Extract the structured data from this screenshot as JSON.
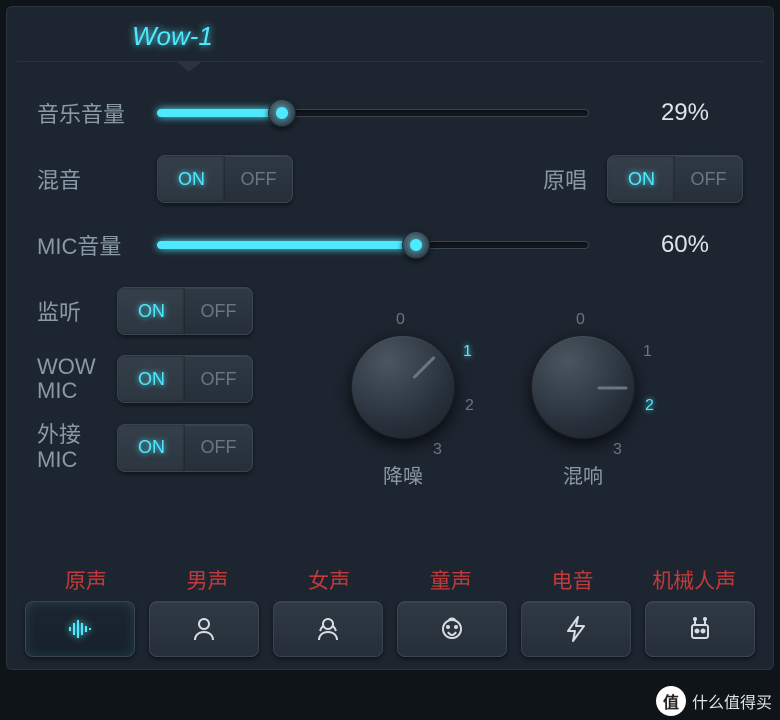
{
  "tab": {
    "title": "Wow-1"
  },
  "sliders": {
    "music": {
      "label": "音乐音量",
      "value": 29,
      "display": "29%"
    },
    "mic": {
      "label": "MIC音量",
      "value": 60,
      "display": "60%"
    }
  },
  "toggles": {
    "mix": {
      "label": "混音",
      "on": "ON",
      "off": "OFF",
      "state": "on"
    },
    "original": {
      "label": "原唱",
      "on": "ON",
      "off": "OFF",
      "state": "on"
    },
    "monitor": {
      "label": "监听",
      "on": "ON",
      "off": "OFF",
      "state": "on"
    },
    "wowmic": {
      "label": "WOW MIC",
      "on": "ON",
      "off": "OFF",
      "state": "on"
    },
    "extmic": {
      "label": "外接 MIC",
      "on": "ON",
      "off": "OFF",
      "state": "on"
    }
  },
  "knobs": {
    "denoise": {
      "label": "降噪",
      "value": 1,
      "ticks": [
        "0",
        "1",
        "2",
        "3"
      ]
    },
    "reverb": {
      "label": "混响",
      "value": 2,
      "ticks": [
        "0",
        "1",
        "2",
        "3"
      ]
    }
  },
  "voices": {
    "labels": [
      "原声",
      "男声",
      "女声",
      "童声",
      "电音",
      "机械人声"
    ],
    "selected": 0
  },
  "watermark": {
    "badge": "值",
    "text": "什么值得买"
  }
}
